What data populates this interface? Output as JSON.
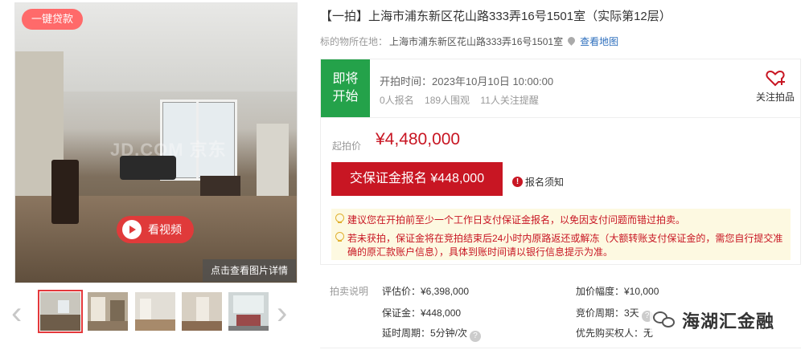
{
  "gallery": {
    "badge": "一键贷款",
    "watermark": "JD.COM 京东",
    "video_label": "看视频",
    "detail_label": "点击查看图片详情",
    "prev_icon": "chevron-left-icon",
    "next_icon": "chevron-right-icon",
    "thumbnail_count": 5,
    "active_thumbnail": 1
  },
  "auction": {
    "title": "【一拍】上海市浦东新区花山路333弄16号1501室（实际第12层）",
    "location_label": "标的物所在地：",
    "location_value": "上海市浦东新区花山路333弄16号1501室",
    "map_link": "查看地图",
    "status_line1": "即将",
    "status_line2": "开始",
    "start_time": "开拍时间：2023年10月10日 10:00:00",
    "registered": "0人报名",
    "watchers": "189人围观",
    "followers": "11人关注提醒",
    "follow_label": "关注拍品",
    "start_price_label": "起拍价",
    "start_price": "¥4,480,000",
    "deposit_button": "交保证金报名 ¥448,000",
    "notice_link": "报名须知",
    "tip1": "建议您在开拍前至少一个工作日支付保证金报名，以免因支付问题而错过拍卖。",
    "tip2_line1": "若未获拍，保证金将在竞拍结束后24小时内原路返还或解冻（大额转账支付保证金的，需您自行提交准",
    "tip2_line2": "确的原汇款账户信息），具体到账时间请以银行信息提示为准。"
  },
  "info": {
    "label": "拍卖说明",
    "appraisal": "评估价：¥6,398,000",
    "increment": "加价幅度：¥10,000",
    "deposit": "保证金：¥448,000",
    "cycle": "竞价周期：3天",
    "delay": "延时周期：5分钟/次",
    "priority": "优先购买权人：无",
    "help_icon": "?"
  },
  "watermark_account": "海湖汇金融",
  "colors": {
    "accent": "#c81623",
    "status_green": "#24a24a",
    "link": "#2e6fbd",
    "tip_bg": "#fdf9e1"
  }
}
